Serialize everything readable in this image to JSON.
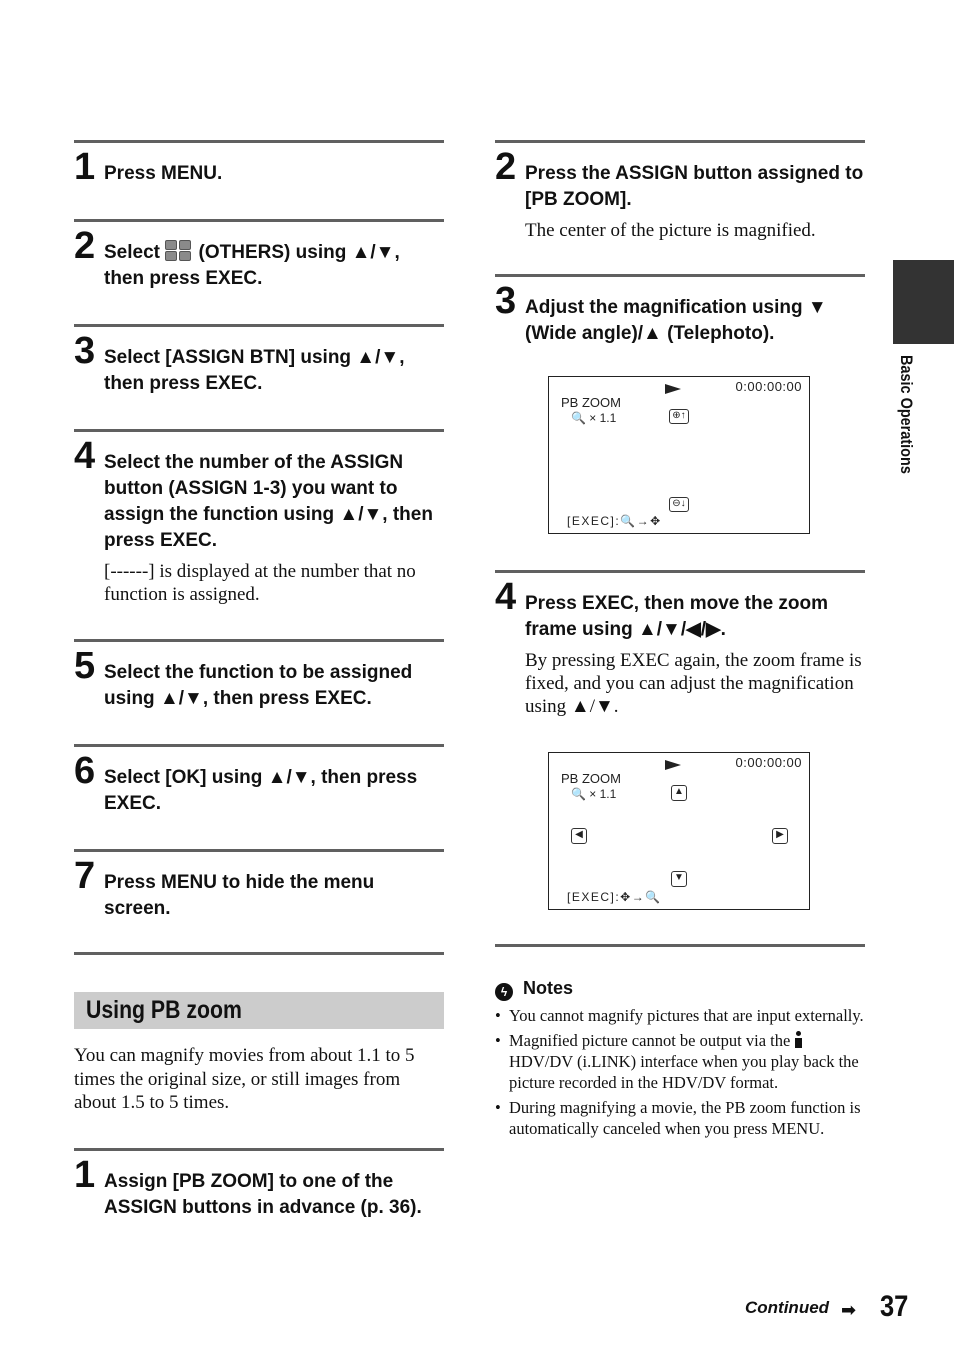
{
  "side_tab": {
    "label": "Basic Operations"
  },
  "left_steps": [
    {
      "num": "1",
      "title": "Press MENU."
    },
    {
      "num": "2",
      "title_pre": "Select ",
      "title_post": " (OTHERS) using ▲/▼, then press EXEC.",
      "icon": "others-icon"
    },
    {
      "num": "3",
      "title": "Select [ASSIGN BTN] using ▲/▼, then press EXEC."
    },
    {
      "num": "4",
      "title": "Select the number of the ASSIGN button (ASSIGN 1-3) you want to assign the function using ▲/▼, then press EXEC.",
      "body": "[------] is displayed at the number that no function is assigned."
    },
    {
      "num": "5",
      "title": "Select the function to be assigned using ▲/▼, then press EXEC."
    },
    {
      "num": "6",
      "title": "Select [OK] using ▲/▼, then press EXEC."
    },
    {
      "num": "7",
      "title": "Press MENU to hide the menu screen."
    }
  ],
  "section": {
    "heading": "Using PB zoom",
    "intro": "You can magnify movies from about 1.1 to 5 times the original size, or still images from about 1.5 to 5 times.",
    "step1": {
      "num": "1",
      "title": "Assign [PB ZOOM] to one of the ASSIGN buttons in advance (p. 36)."
    }
  },
  "right_steps": [
    {
      "num": "2",
      "title": "Press the ASSIGN button assigned to [PB ZOOM].",
      "body": "The center of the picture is magnified."
    },
    {
      "num": "3",
      "title": "Adjust the magnification using ▼ (Wide angle)/▲ (Telephoto)."
    },
    {
      "num": "4",
      "title": "Press EXEC, then move the zoom frame using ▲/▼/◀/▶.",
      "body": "By pressing EXEC again, the zoom frame is fixed, and you can adjust the magnification using ▲/▼."
    }
  ],
  "screen1": {
    "timecode": "0:00:00:00",
    "label": "PB ZOOM",
    "zoom": "🔍 × 1.1",
    "exec": "[EXEC]:🔍→✥",
    "btn_up": "⊕↑",
    "btn_down": "⊖↓"
  },
  "screen2": {
    "timecode": "0:00:00:00",
    "label": "PB ZOOM",
    "zoom": "🔍 × 1.1",
    "exec": "[EXEC]:✥→🔍",
    "btn_up": "▲",
    "btn_down": "▼",
    "btn_left": "◀",
    "btn_right": "▶"
  },
  "notes": {
    "title": "Notes",
    "items": [
      "You cannot magnify pictures that are input externally.",
      {
        "pre": "Magnified picture cannot be output via the ",
        "post": "HDV/DV (i.LINK) interface when you play back the picture recorded in the HDV/DV format."
      },
      "During magnifying a movie, the PB zoom function is automatically canceled when you press MENU."
    ]
  },
  "footer": {
    "continued": "Continued",
    "arrow": "➡",
    "page_number": "37"
  }
}
